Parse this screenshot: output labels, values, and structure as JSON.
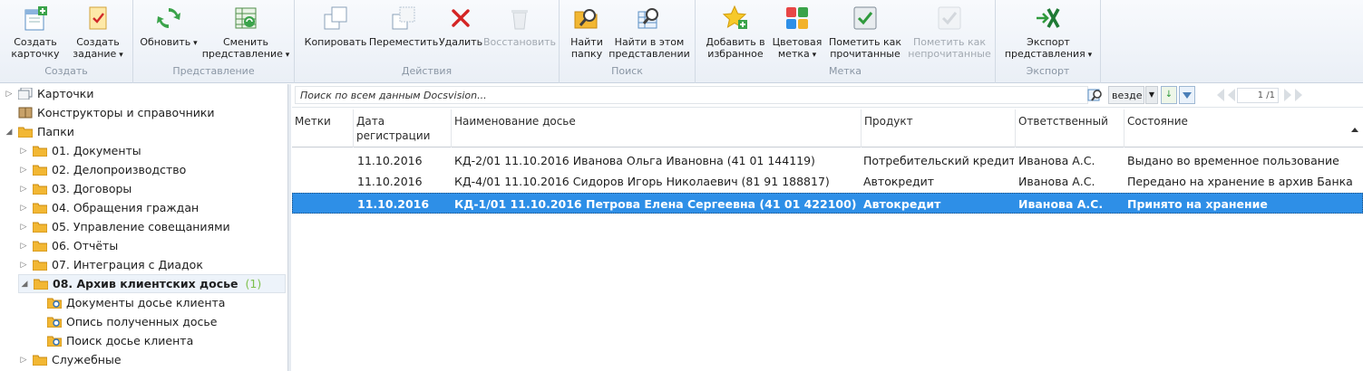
{
  "ribbon": {
    "groups": {
      "create": "Создать",
      "view": "Представление",
      "actions": "Действия",
      "search": "Поиск",
      "mark": "Метка",
      "export": "Экспорт"
    },
    "buttons": {
      "create_card": "Создать\nкарточку",
      "create_task": "Создать\nзадание",
      "refresh": "Обновить",
      "change_view": "Сменить\nпредставление",
      "copy": "Копировать",
      "move": "Переместить",
      "delete": "Удалить",
      "restore": "Восстановить",
      "find_folder": "Найти\nпапку",
      "find_in_view": "Найти в этом\nпредставлении",
      "add_favorite": "Добавить в\nизбранное",
      "color_mark": "Цветовая\nметка",
      "mark_read": "Пометить как\nпрочитанные",
      "mark_unread": "Пометить как\nнепрочитанные",
      "export_view": "Экспорт\nпредставления"
    }
  },
  "tree": {
    "cards": "Карточки",
    "constructors": "Конструкторы и справочники",
    "folders": "Папки",
    "f01": "01. Документы",
    "f02": "02. Делопроизводство",
    "f03": "03. Договоры",
    "f04": "04. Обращения граждан",
    "f05": "05. Управление совещаниями",
    "f06": "06. Отчёты",
    "f07": "07. Интеграция с Диадок",
    "f08": "08. Архив клиентских досье",
    "f08_count": "(1)",
    "sub1": "Документы досье клиента",
    "sub2": "Опись полученных досье",
    "sub3": "Поиск досье клиента",
    "service": "Служебные"
  },
  "search": {
    "placeholder": "Поиск по всем данным Docsvision...",
    "scope": "везде",
    "page": "1 /1"
  },
  "grid": {
    "headers": {
      "marks": "Метки",
      "date": "Дата\nрегистрации",
      "name": "Наименование досье",
      "product": "Продукт",
      "responsible": "Ответственный",
      "state": "Состояние"
    },
    "rows": [
      {
        "date": "11.10.2016",
        "name": "КД-2/01 11.10.2016 Иванова Ольга Ивановна (41 01 144119)",
        "product": "Потребительский кредит",
        "responsible": "Иванова А.С.",
        "state": "Выдано во временное пользование"
      },
      {
        "date": "11.10.2016",
        "name": "КД-4/01 11.10.2016 Сидоров Игорь Николаевич (81 91 188817)",
        "product": "Автокредит",
        "responsible": "Иванова А.С.",
        "state": "Передано на хранение в архив Банка"
      },
      {
        "date": "11.10.2016",
        "name": "КД-1/01 11.10.2016 Петрова Елена Сергеевна (41 01 422100)",
        "product": "Автокредит",
        "responsible": "Иванова А.С.",
        "state": "Принято на хранение"
      }
    ]
  },
  "colors": {
    "selection": "#2e8fe7",
    "accent_green": "#7dc04c"
  }
}
